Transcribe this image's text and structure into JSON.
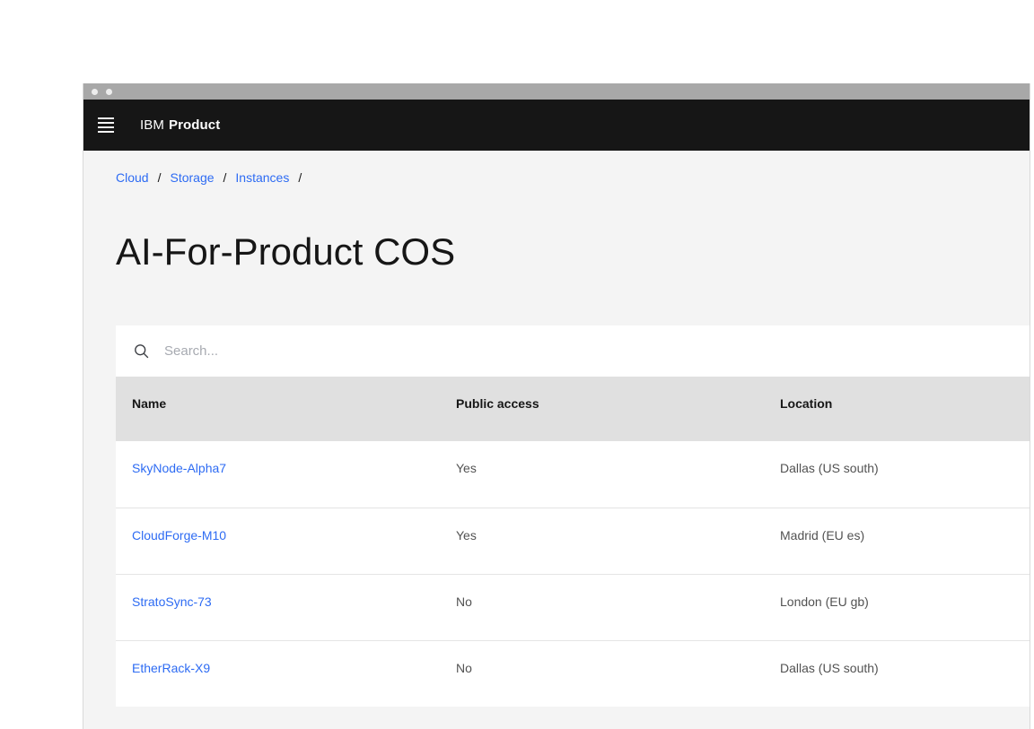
{
  "header": {
    "brand_prefix": "IBM",
    "brand_name": "Product"
  },
  "breadcrumb": {
    "items": [
      "Cloud",
      "Storage",
      "Instances"
    ],
    "separator": "/"
  },
  "page": {
    "title": "AI-For-Product COS"
  },
  "search": {
    "placeholder": "Search...",
    "value": ""
  },
  "table": {
    "columns": [
      "Name",
      "Public access",
      "Location"
    ],
    "rows": [
      {
        "name": "SkyNode-Alpha7",
        "public_access": "Yes",
        "location": "Dallas (US south)"
      },
      {
        "name": "CloudForge-M10",
        "public_access": "Yes",
        "location": "Madrid (EU es)"
      },
      {
        "name": "StratoSync-73",
        "public_access": "No",
        "location": "London (EU gb)"
      },
      {
        "name": "EtherRack-X9",
        "public_access": "No",
        "location": "Dallas (US south)"
      }
    ]
  },
  "colors": {
    "link_blue": "#2d6bf3",
    "app_header_bg": "#161616",
    "content_bg": "#f4f4f4",
    "table_header_bg": "#e0e0e0",
    "titlebar_bg": "#a8a8a8",
    "text_primary": "#161616",
    "text_secondary": "#525252"
  }
}
